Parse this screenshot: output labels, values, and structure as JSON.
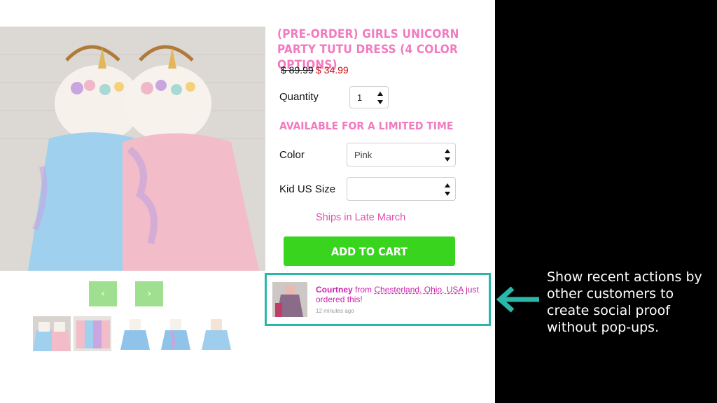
{
  "product": {
    "title": "(PRE-ORDER) GIRLS UNICORN PARTY TUTU DRESS (4 COLOR OPTIONS)",
    "price_old": "$ 89.99",
    "price_new": "$ 34.99",
    "quantity_label": "Quantity",
    "quantity_value": "1",
    "limited_notice": "AVAILABLE FOR A LIMITED TIME",
    "color_label": "Color",
    "color_value": "Pink",
    "size_label": "Kid US Size",
    "size_value": "",
    "ships_text": "Ships in Late March",
    "add_to_cart": "ADD TO CART"
  },
  "gallery": {
    "prev": "‹",
    "next": "›",
    "thumbnails": [
      "dress-pair",
      "dress-rack",
      "blue-dress",
      "blue-dress-alt",
      "blue-dress-side"
    ]
  },
  "social_proof": {
    "name": "Courtney",
    "from_word": "from",
    "location": "Chesterland, Ohio, USA",
    "action": "just ordered this!",
    "time": "12 minutes ago"
  },
  "callout": {
    "text": "Show recent actions by other customers to create social proof without pop-ups."
  },
  "colors": {
    "accent_pink": "#f27ac0",
    "cart_green": "#39d41d",
    "arrow_teal": "#2ab7a9",
    "price_red": "#cc1111"
  }
}
